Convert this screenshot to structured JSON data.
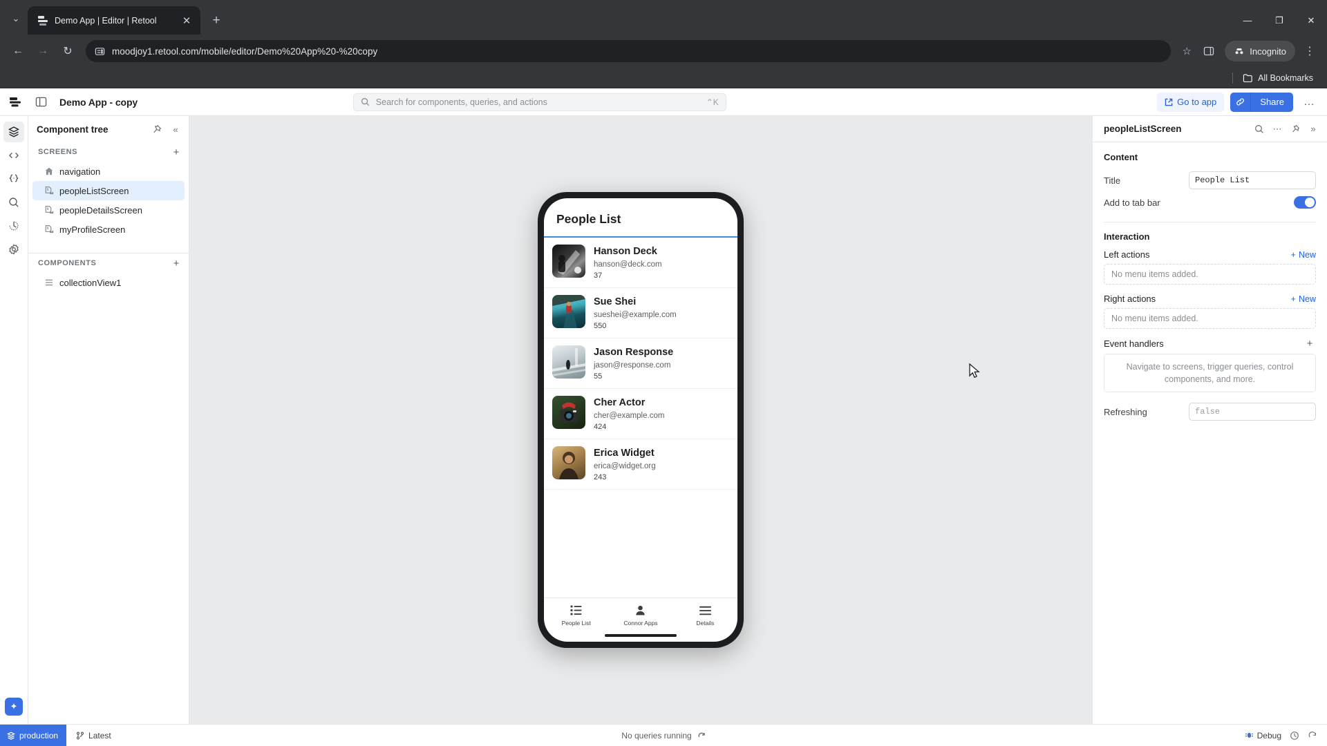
{
  "browser": {
    "tab": {
      "title": "Demo App | Editor | Retool",
      "close_label": "✕"
    },
    "new_tab_label": "+",
    "tab_list_chevron": "⌄",
    "window": {
      "minimize": "—",
      "maximize": "❐",
      "close": "✕"
    },
    "nav": {
      "back": "←",
      "forward": "→",
      "reload": "↻"
    },
    "url": "moodjoy1.retool.com/mobile/editor/Demo%20App%20-%20copy",
    "star": "☆",
    "profile_label": "Incognito",
    "menu": "⋮",
    "bookmarks": {
      "label": "All Bookmarks"
    }
  },
  "header": {
    "app_name": "Demo App - copy",
    "search_placeholder": "Search for components, queries, and actions",
    "search_shortcut": "⌃K",
    "go_to_app_label": "Go to app",
    "share_label": "Share",
    "more_label": "…"
  },
  "rail": {
    "items": [
      {
        "name": "layers",
        "glyph": "layers"
      },
      {
        "name": "code",
        "glyph": "code"
      },
      {
        "name": "state",
        "glyph": "state"
      },
      {
        "name": "search",
        "glyph": "search"
      },
      {
        "name": "history",
        "glyph": "history"
      },
      {
        "name": "settings",
        "glyph": "settings"
      }
    ],
    "ai_label": "✦"
  },
  "tree": {
    "title": "Component tree",
    "pin_icon": "📌",
    "collapse_icon": "«",
    "screens_label": "SCREENS",
    "screens_add": "+",
    "screens": [
      {
        "label": "navigation",
        "icon": "home",
        "selected": false
      },
      {
        "label": "peopleListScreen",
        "icon": "screen",
        "selected": true
      },
      {
        "label": "peopleDetailsScreen",
        "icon": "screen",
        "selected": false
      },
      {
        "label": "myProfileScreen",
        "icon": "screen",
        "selected": false
      }
    ],
    "components_label": "COMPONENTS",
    "components_add": "+",
    "components": [
      {
        "label": "collectionView1",
        "icon": "list"
      }
    ]
  },
  "phone": {
    "title": "People List",
    "people": [
      {
        "name": "Hanson Deck",
        "email": "hanson@deck.com",
        "number": "37",
        "avatar_c1": "#2b2b2b",
        "avatar_c2": "#6e6e6e"
      },
      {
        "name": "Sue Shei",
        "email": "sueshei@example.com",
        "number": "550",
        "avatar_c1": "#1e6e78",
        "avatar_c2": "#7fd4dd"
      },
      {
        "name": "Jason Response",
        "email": "jason@response.com",
        "number": "55",
        "avatar_c1": "#9aa6a8",
        "avatar_c2": "#d7e0e2"
      },
      {
        "name": "Cher Actor",
        "email": "cher@example.com",
        "number": "424",
        "avatar_c1": "#2f4a33",
        "avatar_c2": "#b8413c"
      },
      {
        "name": "Erica Widget",
        "email": "erica@widget.org",
        "number": "243",
        "avatar_c1": "#7a5c3a",
        "avatar_c2": "#caa86f"
      }
    ],
    "tabs": [
      {
        "label": "People List",
        "icon": "list"
      },
      {
        "label": "Connor Apps",
        "icon": "person"
      },
      {
        "label": "Details",
        "icon": "menu"
      }
    ]
  },
  "inspector": {
    "title": "peopleListScreen",
    "search_icon": "⌕",
    "more_icon": "⋯",
    "pin_icon": "📌",
    "expand_icon": "»",
    "content_title": "Content",
    "title_label": "Title",
    "title_value": "People List",
    "tabbar_label": "Add to tab bar",
    "tabbar_on": true,
    "interaction_title": "Interaction",
    "left_actions_label": "Left actions",
    "left_actions_new": "New",
    "left_actions_empty": "No menu items added.",
    "right_actions_label": "Right actions",
    "right_actions_new": "New",
    "right_actions_empty": "No menu items added.",
    "event_handlers_label": "Event handlers",
    "event_handlers_add": "+",
    "event_handlers_empty": "Navigate to screens, trigger queries, control components, and more.",
    "refreshing_label": "Refreshing",
    "refreshing_value": "false"
  },
  "status": {
    "environment": "production",
    "branch": "Latest",
    "queries": "No queries running",
    "debug": "Debug"
  },
  "colors": {
    "accent": "#3970e4",
    "accent_soft": "#eef3fe",
    "selected_row": "#e3effc"
  }
}
